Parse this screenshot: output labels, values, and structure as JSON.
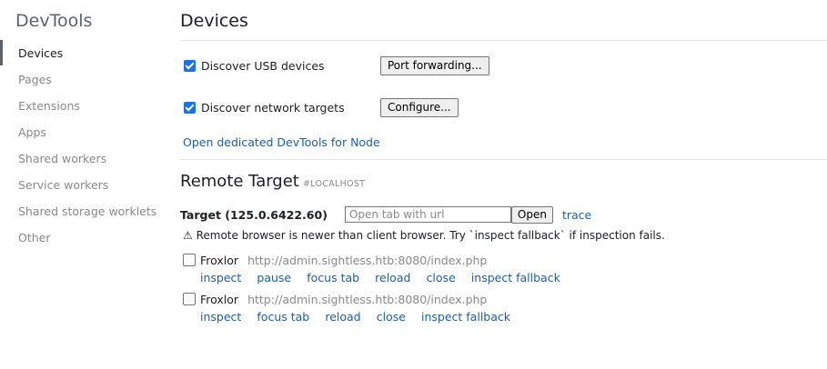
{
  "sidebar": {
    "title": "DevTools",
    "items": [
      {
        "label": "Devices"
      },
      {
        "label": "Pages"
      },
      {
        "label": "Extensions"
      },
      {
        "label": "Apps"
      },
      {
        "label": "Shared workers"
      },
      {
        "label": "Service workers"
      },
      {
        "label": "Shared storage worklets"
      },
      {
        "label": "Other"
      }
    ],
    "selected_item": "Devices"
  },
  "main": {
    "title": "Devices",
    "discover_usb": {
      "label": "Discover USB devices",
      "checked": true,
      "button": "Port forwarding..."
    },
    "discover_network": {
      "label": "Discover network targets",
      "checked": true,
      "button": "Configure..."
    },
    "node_link": "Open dedicated DevTools for Node",
    "remote": {
      "title": "Remote Target",
      "host": "#LOCALHOST",
      "target_name": "Target (125.0.6422.60)",
      "url_placeholder": "Open tab with url",
      "open_button": "Open",
      "trace_link": "trace",
      "warning": "⚠ Remote browser is newer than client browser. Try `inspect fallback` if inspection fails.",
      "pages": [
        {
          "name": "Froxlor",
          "url": "http://admin.sightless.htb:8080/index.php",
          "actions": [
            "inspect",
            "pause",
            "focus tab",
            "reload",
            "close",
            "inspect fallback"
          ]
        },
        {
          "name": "Froxlor",
          "url": "http://admin.sightless.htb:8080/index.php",
          "actions": [
            "inspect",
            "focus tab",
            "reload",
            "close",
            "inspect fallback"
          ]
        }
      ]
    }
  },
  "colors": {
    "link": "#1a5fb4",
    "checkbox": "#1a73e8",
    "muted": "#8a8a8a"
  }
}
